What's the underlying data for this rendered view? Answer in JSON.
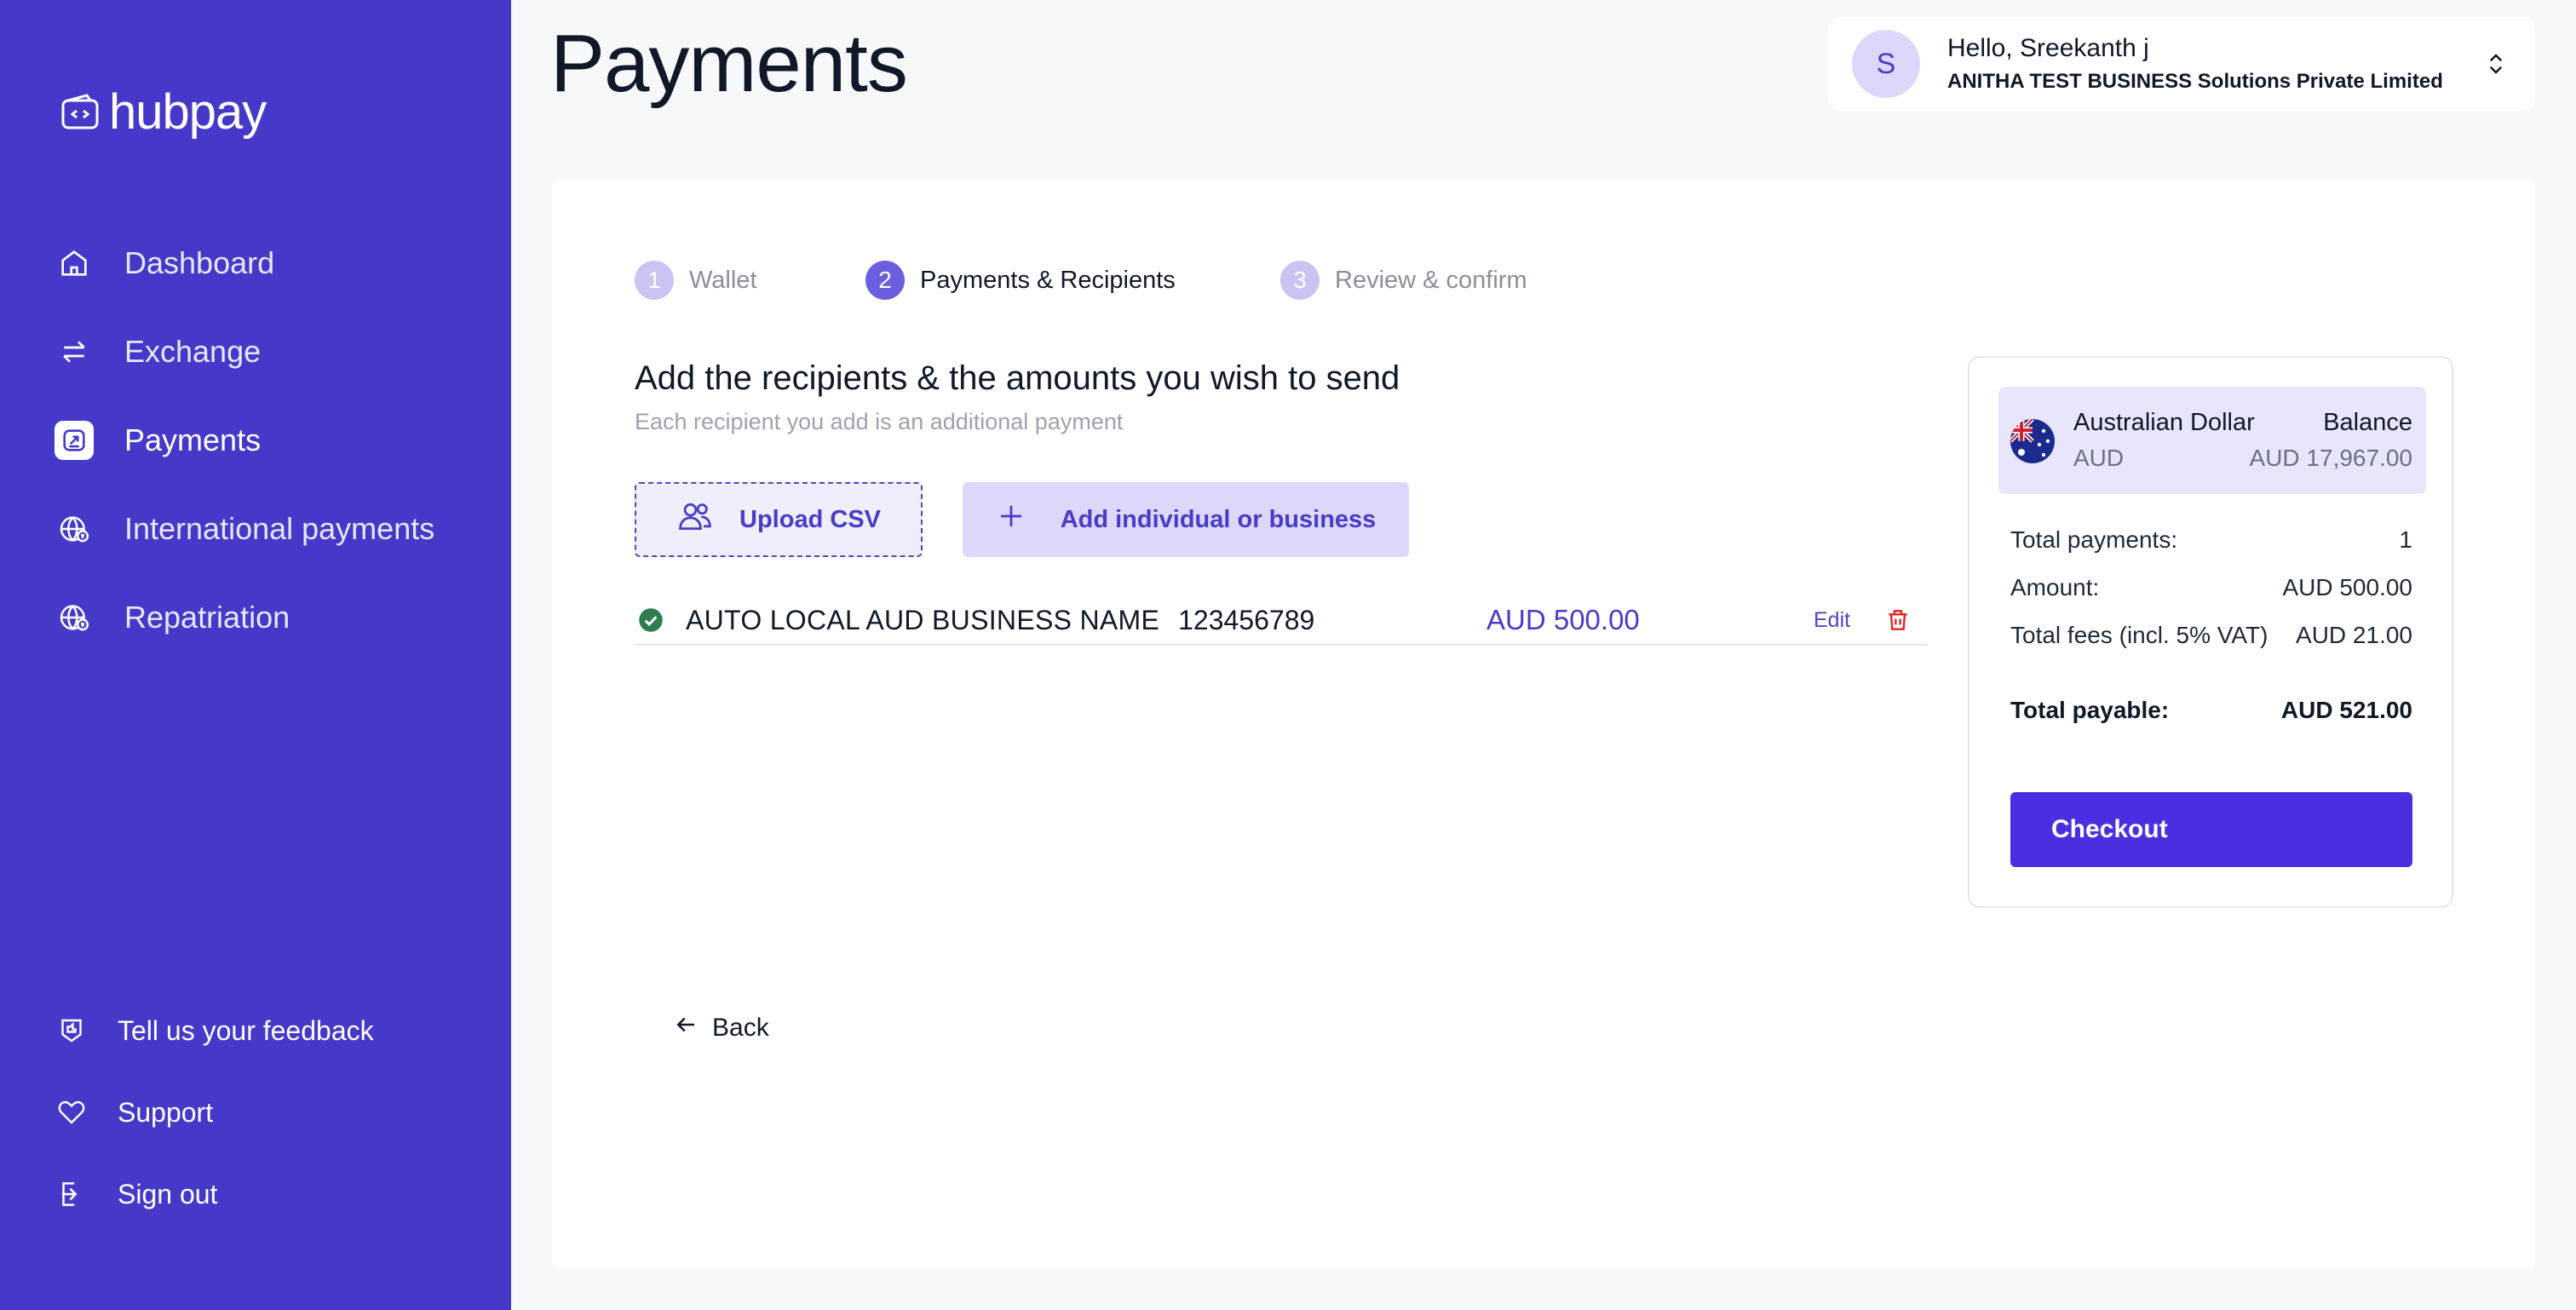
{
  "brand": {
    "name": "hubpay"
  },
  "sidebar": {
    "items": [
      {
        "label": "Dashboard",
        "icon": "home-icon"
      },
      {
        "label": "Exchange",
        "icon": "exchange-icon"
      },
      {
        "label": "Payments",
        "icon": "payments-icon",
        "active": true
      },
      {
        "label": "International payments",
        "icon": "globe-icon"
      },
      {
        "label": "Repatriation",
        "icon": "globe-icon"
      }
    ],
    "footer": [
      {
        "label": "Tell us your feedback",
        "icon": "feedback-icon"
      },
      {
        "label": "Support",
        "icon": "heart-icon"
      },
      {
        "label": "Sign out",
        "icon": "sign-out-icon"
      }
    ]
  },
  "header": {
    "title": "Payments",
    "user": {
      "initial": "S",
      "greeting": "Hello, Sreekanth j",
      "company": "ANITHA TEST BUSINESS Solutions Private Limited"
    }
  },
  "stepper": [
    {
      "num": "1",
      "label": "Wallet",
      "state": "inactive"
    },
    {
      "num": "2",
      "label": "Payments & Recipients",
      "state": "active"
    },
    {
      "num": "3",
      "label": "Review & confirm",
      "state": "inactive"
    }
  ],
  "recipients_section": {
    "title": "Add the recipients & the amounts you wish to send",
    "subtitle": "Each recipient you add is an additional payment",
    "upload_label": "Upload CSV",
    "add_label": "Add individual or business"
  },
  "recipients": [
    {
      "name": "AUTO LOCAL AUD BUSINESS NAME",
      "account": "123456789",
      "amount": "AUD 500.00",
      "edit_label": "Edit"
    }
  ],
  "back_label": "Back",
  "summary": {
    "currency_name": "Australian Dollar",
    "currency_code": "AUD",
    "balance_label": "Balance",
    "balance_value": "AUD 17,967.00",
    "total_payments_label": "Total payments:",
    "total_payments_value": "1",
    "amount_label": "Amount:",
    "amount_value": "AUD 500.00",
    "fees_label": "Total fees (incl. 5% VAT)",
    "fees_value": "AUD 21.00",
    "total_payable_label": "Total payable:",
    "total_payable_value": "AUD 521.00",
    "checkout_label": "Checkout"
  },
  "colors": {
    "sidebar": "#4639c9",
    "accent": "#4a2fe0",
    "amount": "#4a3bc8",
    "success": "#2e7d4f",
    "danger": "#e02424"
  }
}
